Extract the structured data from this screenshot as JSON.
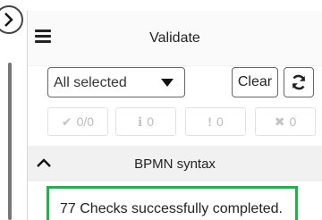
{
  "panel": {
    "title": "Validate"
  },
  "filter": {
    "selected_label": "All selected",
    "clear_label": "Clear"
  },
  "counts": [
    {
      "icon": "check-icon",
      "glyph": "✔",
      "label": "0/0"
    },
    {
      "icon": "info-icon",
      "glyph": "ℹ",
      "label": "0"
    },
    {
      "icon": "warning-icon",
      "glyph": "!",
      "label": "0"
    },
    {
      "icon": "error-icon",
      "glyph": "✖",
      "label": "0"
    }
  ],
  "section": {
    "title": "BPMN syntax"
  },
  "result": {
    "message": "77 Checks successfully completed."
  },
  "colors": {
    "success_border": "#2fa84f",
    "section_bg": "#f1f1f1"
  }
}
